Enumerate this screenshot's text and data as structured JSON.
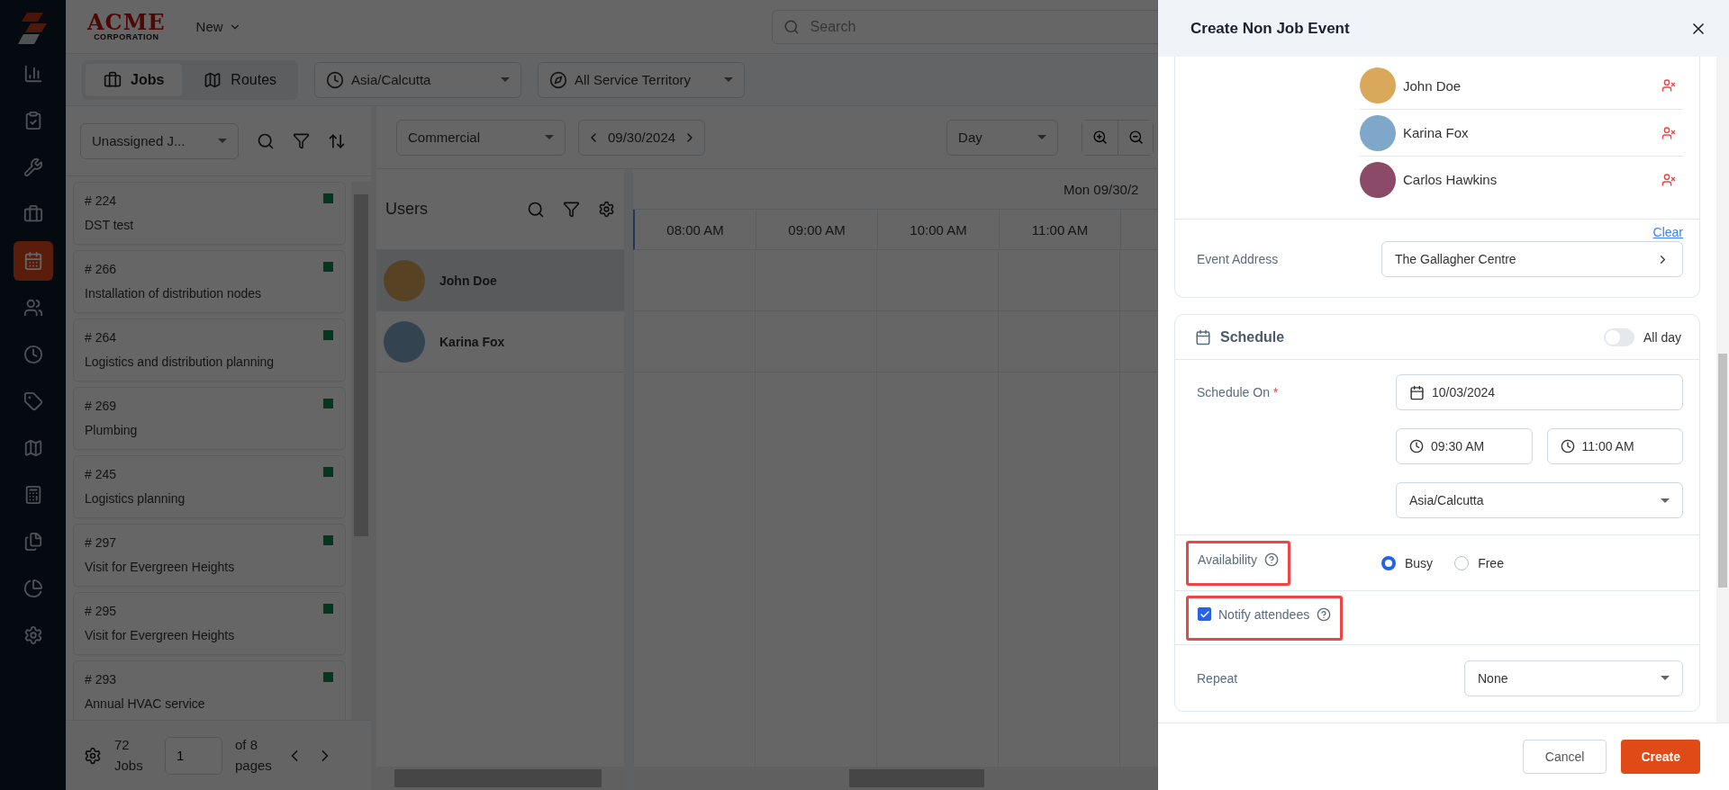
{
  "header": {
    "logo": {
      "title": "ACME",
      "subtitle": "CORPORATION"
    },
    "new_menu": "New",
    "search": {
      "placeholder": "Search"
    }
  },
  "sidebar": {
    "items": [
      {
        "kind": "chart",
        "selected": false
      },
      {
        "kind": "clipboard",
        "selected": false
      },
      {
        "kind": "tools",
        "selected": false
      },
      {
        "kind": "briefcase",
        "selected": false
      },
      {
        "kind": "calendar",
        "selected": true
      },
      {
        "kind": "users",
        "selected": false
      },
      {
        "kind": "clock",
        "selected": false
      },
      {
        "kind": "tag",
        "selected": false
      },
      {
        "kind": "map",
        "selected": false
      },
      {
        "kind": "calculator",
        "selected": false
      },
      {
        "kind": "files",
        "selected": false
      },
      {
        "kind": "pie",
        "selected": false
      },
      {
        "kind": "settings",
        "selected": false
      }
    ]
  },
  "toolbar": {
    "view_tabs": [
      {
        "label": "Jobs",
        "kind": "briefcase",
        "selected": true
      },
      {
        "label": "Routes",
        "kind": "map",
        "selected": false
      }
    ],
    "timezone": "Asia/Calcutta",
    "territory": "All Service Territory"
  },
  "jobs_panel": {
    "filter": "Unassigned J...",
    "jobs": [
      {
        "number": "# 224",
        "title": "DST test"
      },
      {
        "number": "# 266",
        "title": "Installation of distribution nodes"
      },
      {
        "number": "# 264",
        "title": "Logistics and distribution planning"
      },
      {
        "number": "# 269",
        "title": "Plumbing"
      },
      {
        "number": "# 245",
        "title": "Logistics planning"
      },
      {
        "number": "# 297",
        "title": "Visit for Evergreen Heights"
      },
      {
        "number": "# 295",
        "title": "Visit for Evergreen Heights"
      },
      {
        "number": "# 293",
        "title": "Annual HVAC service"
      }
    ],
    "footer": {
      "total": "72 Jobs",
      "page": "1",
      "pages": "of 8 pages"
    }
  },
  "scheduler": {
    "category": "Commercial",
    "date": "09/30/2024",
    "view": "Day",
    "users_title": "Users",
    "users": [
      {
        "name": "John Doe",
        "selected": true
      },
      {
        "name": "Karina Fox",
        "selected": false
      }
    ],
    "day_header": "Mon 09/30/2",
    "times": [
      "08:00 AM",
      "09:00 AM",
      "10:00 AM",
      "11:00 AM"
    ]
  },
  "dialog": {
    "title": "Create Non Job Event",
    "attendees": [
      {
        "name": "John Doe"
      },
      {
        "name": "Karina Fox"
      },
      {
        "name": "Carlos Hawkins"
      }
    ],
    "event_address": {
      "label": "Event Address",
      "value": "The Gallagher Centre",
      "clear": "Clear"
    },
    "schedule": {
      "title": "Schedule",
      "all_day": {
        "label": "All day",
        "on": false
      },
      "schedule_on": {
        "label": "Schedule On",
        "required_mark": "*",
        "date": "10/03/2024",
        "start": "09:30 AM",
        "end": "11:00 AM",
        "timezone": "Asia/Calcutta"
      }
    },
    "availability": {
      "label": "Availability",
      "highlighted": true,
      "options": [
        {
          "label": "Busy",
          "selected": true
        },
        {
          "label": "Free",
          "selected": false
        }
      ]
    },
    "notify": {
      "label": "Notify attendees",
      "checked": true,
      "highlighted": true
    },
    "repeat": {
      "label": "Repeat",
      "value": "None"
    },
    "buttons": {
      "cancel": "Cancel",
      "create": "Create"
    }
  }
}
